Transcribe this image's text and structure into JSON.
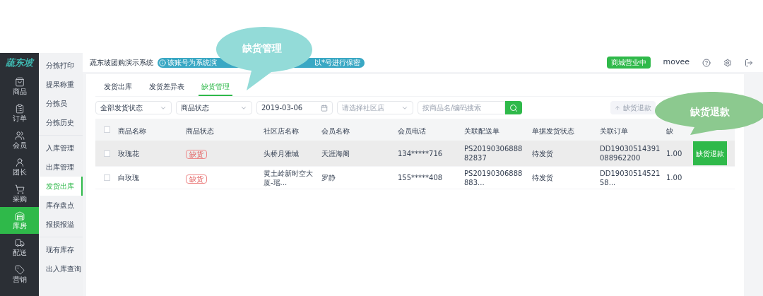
{
  "logo": "蔬东坡",
  "nav": [
    {
      "label": "商品",
      "selected": false
    },
    {
      "label": "订单",
      "selected": false
    },
    {
      "label": "会员",
      "selected": false
    },
    {
      "label": "团长",
      "selected": false
    },
    {
      "label": "采购",
      "selected": false
    },
    {
      "label": "库房",
      "selected": true
    },
    {
      "label": "配送",
      "selected": false
    },
    {
      "label": "营销",
      "selected": false
    }
  ],
  "subnav": [
    [
      {
        "label": "分拣打印",
        "selected": false
      },
      {
        "label": "提果称重",
        "selected": false
      },
      {
        "label": "分拣员",
        "selected": false
      },
      {
        "label": "分拣历史",
        "selected": false
      }
    ],
    [
      {
        "label": "入库管理",
        "selected": false
      },
      {
        "label": "出库管理",
        "selected": false
      },
      {
        "label": "发货出库",
        "selected": true
      },
      {
        "label": "库存盘点",
        "selected": false
      },
      {
        "label": "报损报溢",
        "selected": false
      }
    ],
    [
      {
        "label": "现有库存",
        "selected": false
      },
      {
        "label": "出入库查询",
        "selected": false
      }
    ]
  ],
  "header": {
    "title": "蔬东坡团购演示系统",
    "notice": [
      "该账号为系统演",
      "以*号进行保密"
    ],
    "store_status": "商城营业中",
    "user": "movee"
  },
  "tabs": [
    {
      "label": "发货出库",
      "selected": false
    },
    {
      "label": "发货差异表",
      "selected": false
    },
    {
      "label": "缺货管理",
      "selected": true
    }
  ],
  "filters": [
    {
      "kind": "select",
      "value": "全部发货状态"
    },
    {
      "kind": "select",
      "value": "商品状态"
    },
    {
      "kind": "date",
      "value": "2019-03-06"
    },
    {
      "kind": "select",
      "placeholder": "请选择社区店"
    },
    {
      "kind": "search",
      "placeholder": "按商品名/编码搜索"
    }
  ],
  "refund_button": "缺货退款",
  "table": {
    "header_checked": false,
    "columns": [
      "商品名称",
      "商品状态",
      "社区店名称",
      "会员名称",
      "会员电话",
      "关联配送单",
      "单据发货状态",
      "关联订单",
      "缺"
    ],
    "rows": [
      {
        "selected": true,
        "checked": false,
        "cells": [
          "玫瑰花",
          "缺货",
          "头桥月雅城",
          "天涯海阁",
          "134*****716",
          "PS2019030688882837",
          "待发货",
          "DD19030514391088962200",
          "1.00"
        ],
        "action": "缺货退款"
      },
      {
        "selected": false,
        "checked": false,
        "cells": [
          "白玫瑰",
          "缺货",
          "黄土岭新时空大厦-瑶...",
          "罗静",
          "155*****408",
          "PS20190306888883...",
          "待发货",
          "DD1903051452158...",
          "1.00"
        ]
      }
    ]
  },
  "callouts": [
    {
      "text": "缺货管理",
      "color": "#93dbd8"
    },
    {
      "text": "缺货退款",
      "color": "#8cc98f"
    }
  ]
}
